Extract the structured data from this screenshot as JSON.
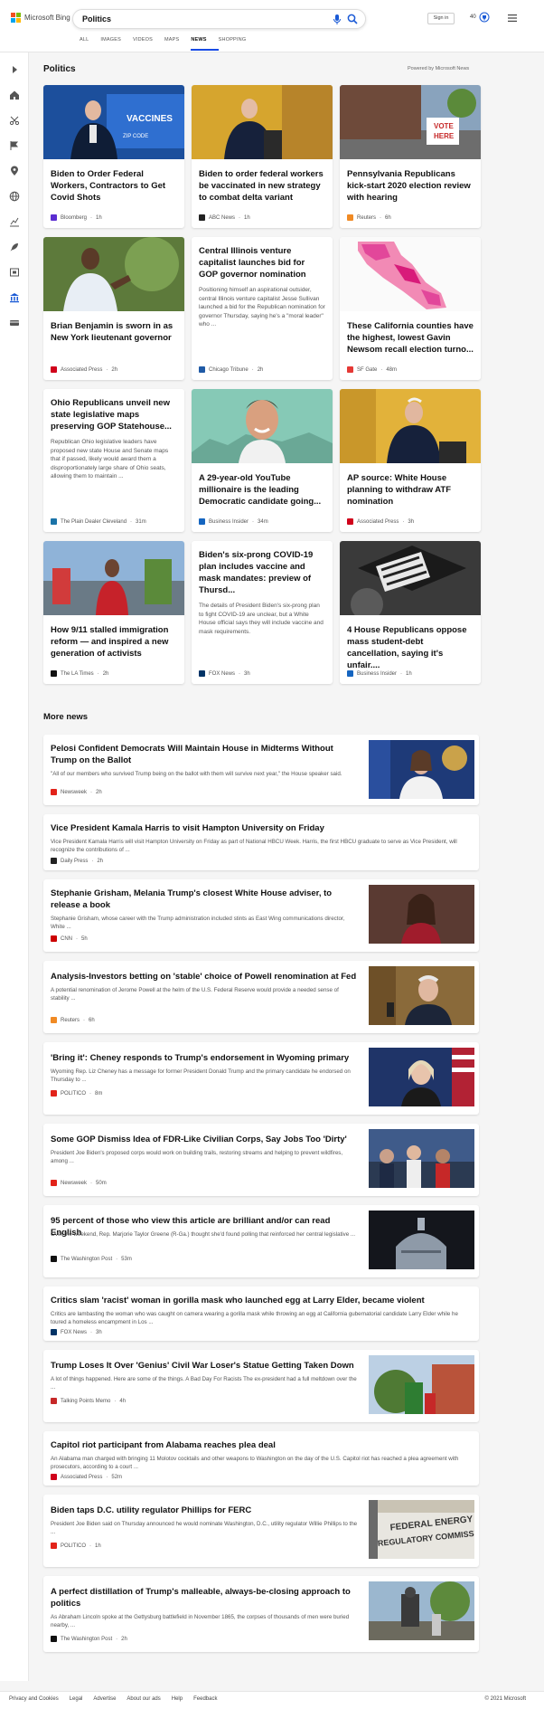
{
  "header": {
    "brand": "Microsoft Bing",
    "search_value": "Politics",
    "tabs": [
      "ALL",
      "IMAGES",
      "VIDEOS",
      "MAPS",
      "NEWS",
      "SHOPPING"
    ],
    "active_tab": "NEWS",
    "signin": "Sign in",
    "reward_count": "40"
  },
  "section": {
    "title": "Politics",
    "powered": "Powered by Microsoft News"
  },
  "cards": [
    {
      "title": "Biden to Order Federal Workers, Contractors to Get Covid Shots",
      "snippet": "",
      "source": "Bloomberg",
      "time": "1h",
      "logo_color": "#5b2dd1"
    },
    {
      "title": "Biden to order federal workers be vaccinated in new strategy to combat delta variant",
      "snippet": "",
      "source": "ABC News",
      "time": "1h",
      "logo_color": "#222222"
    },
    {
      "title": "Pennsylvania Republicans kick-start 2020 election review with hearing",
      "snippet": "",
      "source": "Reuters",
      "time": "6h",
      "logo_color": "#f08a24"
    },
    {
      "title": "Brian Benjamin is sworn in as New York lieutenant governor",
      "snippet": "",
      "source": "Associated Press",
      "time": "2h",
      "logo_color": "#d0021b"
    },
    {
      "title": "Central Illinois venture capitalist launches bid for GOP governor nomination",
      "snippet": "Positioning himself an aspirational outsider, central Illinois venture capitalist Jesse Sullivan launched a bid for the Republican nomination for governor Thursday, saying he's a \"moral leader\" who ...",
      "source": "Chicago Tribune",
      "time": "2h",
      "logo_color": "#1f5aa6"
    },
    {
      "title": "These California counties have the highest, lowest Gavin Newsom recall election turno...",
      "snippet": "",
      "source": "SF Gate",
      "time": "48m",
      "logo_color": "#e53935"
    },
    {
      "title": "Ohio Republicans unveil new state legislative maps preserving GOP Statehouse...",
      "snippet": "Republican Ohio legislative leaders have proposed new state House and Senate maps that if passed, likely would award them a disproportionately large share of Ohio seats, allowing them to maintain ...",
      "source": "The Plain Dealer Cleveland",
      "time": "31m",
      "logo_color": "#1a73a8"
    },
    {
      "title": "A 29-year-old YouTube millionaire is the leading Democratic candidate going...",
      "snippet": "",
      "source": "Business Insider",
      "time": "34m",
      "logo_color": "#1565c0"
    },
    {
      "title": "AP source: White House planning to withdraw ATF nomination",
      "snippet": "",
      "source": "Associated Press",
      "time": "3h",
      "logo_color": "#d0021b"
    },
    {
      "title": "How 9/11 stalled immigration reform — and inspired a new generation of activists",
      "snippet": "",
      "source": "The LA Times",
      "time": "2h",
      "logo_color": "#111111"
    },
    {
      "title": "Biden's six-prong COVID-19 plan includes vaccine and mask mandates: preview of Thursd...",
      "snippet": "The details of President Biden's six-prong plan to fight COVID-19 are unclear, but a White House official says they will include vaccine and mask requirements.",
      "source": "FOX News",
      "time": "3h",
      "logo_color": "#003366"
    },
    {
      "title": "4 House Republicans oppose mass student-debt cancellation, saying it's unfair....",
      "snippet": "",
      "source": "Business Insider",
      "time": "1h",
      "logo_color": "#1565c0"
    }
  ],
  "more": {
    "title": "More news",
    "items": [
      {
        "title": "Pelosi Confident Democrats Will Maintain House in Midterms Without Trump on the Ballot",
        "snippet": "\"All of our members who survived Trump being on the ballot with them will survive next year,\" the House speaker said.",
        "source": "Newsweek",
        "time": "2h",
        "logo_color": "#e2231a"
      },
      {
        "title": "Vice President Kamala Harris to visit Hampton University on Friday",
        "snippet": "Vice President Kamala Harris will visit Hampton University on Friday as part of National HBCU Week. Harris, the first HBCU graduate to serve as Vice President, will recognize the contributions of ...",
        "source": "Daily Press",
        "time": "2h",
        "logo_color": "#222222"
      },
      {
        "title": "Stephanie Grisham, Melania Trump's closest White House adviser, to release a book",
        "snippet": "Stephanie Grisham, whose career with the Trump administration included stints as East Wing communications director, White ...",
        "source": "CNN",
        "time": "5h",
        "logo_color": "#cc0000"
      },
      {
        "title": "Analysis-Investors betting on 'stable' choice of Powell renomination at Fed",
        "snippet": "A potential renomination of Jerome Powell at the helm of the U.S. Federal Reserve would provide a needed sense of stability ...",
        "source": "Reuters",
        "time": "6h",
        "logo_color": "#f08a24"
      },
      {
        "title": "'Bring it': Cheney responds to Trump's endorsement in Wyoming primary",
        "snippet": "Wyoming Rep. Liz Cheney has a message for former President Donald Trump and the primary candidate he endorsed on Thursday to ...",
        "source": "POLITICO",
        "time": "8m",
        "logo_color": "#e2231a"
      },
      {
        "title": "Some GOP Dismiss Idea of FDR-Like Civilian Corps, Say Jobs Too 'Dirty'",
        "snippet": "President Joe Biden's proposed corps would work on building trails, restoring streams and helping to prevent wildfires, among ...",
        "source": "Newsweek",
        "time": "50m",
        "logo_color": "#e2231a"
      },
      {
        "title": "95 percent of those who view this article are brilliant and/or can read English",
        "snippet": "Over the weekend, Rep. Marjorie Taylor Greene (R-Ga.) thought she'd found polling that reinforced her central legislative ...",
        "source": "The Washington Post",
        "time": "53m",
        "logo_color": "#111111"
      },
      {
        "title": "Critics slam 'racist' woman in gorilla mask who launched egg at Larry Elder, became violent",
        "snippet": "Critics are lambasting the woman who was caught on camera wearing a gorilla mask while throwing an egg at California gubernatorial candidate Larry Elder while he toured a homeless encampment in Los ...",
        "source": "FOX News",
        "time": "3h",
        "logo_color": "#003366"
      },
      {
        "title": "Trump Loses It Over 'Genius' Civil War Loser's Statue Getting Taken Down",
        "snippet": "A lot of things happened. Here are some of the things. A Bad Day For Racists The ex-president had a full meltdown over the ...",
        "source": "Talking Points Memo",
        "time": "4h",
        "logo_color": "#c62828"
      },
      {
        "title": "Capitol riot participant from Alabama reaches plea deal",
        "snippet": "An Alabama man charged with bringing 11 Molotov cocktails and other weapons to Washington on the day of the U.S. Capitol riot has reached a plea agreement with prosecutors, according to a court ...",
        "source": "Associated Press",
        "time": "52m",
        "logo_color": "#d0021b"
      },
      {
        "title": "Biden taps D.C. utility regulator Phillips for FERC",
        "snippet": "President Joe Biden said on Thursday announced he would nominate Washington, D.C., utility regulator Willie Phillips to the ...",
        "source": "POLITICO",
        "time": "1h",
        "logo_color": "#e2231a"
      },
      {
        "title": "A perfect distillation of Trump's malleable, always-be-closing approach to politics",
        "snippet": "As Abraham Lincoln spoke at the Gettysburg battlefield in November 1865, the corpses of thousands of men were buried nearby, ...",
        "source": "The Washington Post",
        "time": "2h",
        "logo_color": "#111111"
      }
    ]
  },
  "footer": {
    "links": [
      "Privacy and Cookies",
      "Legal",
      "Advertise",
      "About our ads",
      "Help",
      "Feedback"
    ],
    "copyright": "© 2021 Microsoft"
  }
}
